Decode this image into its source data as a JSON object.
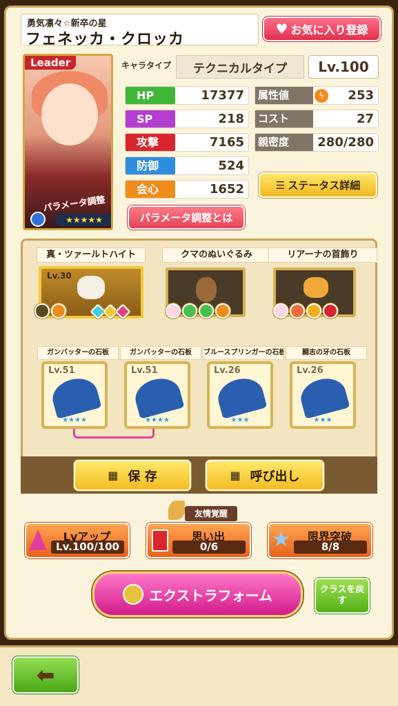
{
  "header": {
    "subtitle": "勇気凛々☆新卒の星",
    "name": "フェネッカ・クロッカ",
    "favorite_label": "お気に入り登録"
  },
  "portrait": {
    "leader": "Leader",
    "param_tag": "パラメータ調整",
    "stars": "★★★★★"
  },
  "chartype": {
    "label": "キャラタイプ",
    "value": "テクニカルタイプ",
    "level": "Lv.100"
  },
  "stats": [
    {
      "label": "HP",
      "value": "17377",
      "color": "#3fb83a"
    },
    {
      "label": "SP",
      "value": "218",
      "color": "#b33ed1"
    },
    {
      "label": "攻撃",
      "value": "7165",
      "color": "#d9252d"
    },
    {
      "label": "防御",
      "value": "524",
      "color": "#2f8de0"
    },
    {
      "label": "会心",
      "value": "1652",
      "color": "#f08c1c"
    }
  ],
  "stats2": [
    {
      "label": "属性値",
      "value": "253"
    },
    {
      "label": "コスト",
      "value": "27"
    },
    {
      "label": "親密度",
      "value": "280/280"
    }
  ],
  "buttons": {
    "status_detail": "ステータス詳細",
    "param_about": "パラメータ調整とは",
    "save": "保 存",
    "load": "呼び出し",
    "level_up": "Lvアップ",
    "memory": "思い出",
    "limit_break": "限界突破",
    "extra_form": "エクストラフォーム",
    "class_back": "クラスを戻す",
    "friendship": "友情覚醒"
  },
  "equipment": [
    {
      "name": "真・ツァールトハイト",
      "level": "Lv.30"
    },
    {
      "name": "クマのぬいぐるみ",
      "level": ""
    },
    {
      "name": "リアーナの首飾り",
      "level": ""
    }
  ],
  "slates": [
    {
      "name": "ガンバッターの石板",
      "level": "Lv.51",
      "stars": "★★★★"
    },
    {
      "name": "ガンバッターの石板",
      "level": "Lv.51",
      "stars": "★★★★"
    },
    {
      "name": "ブルースプリンガーの石板",
      "level": "Lv.26",
      "stars": "★★★"
    },
    {
      "name": "闘志の牙の石板",
      "level": "Lv.26",
      "stars": "★★★"
    }
  ],
  "progress": {
    "level": "Lv.100/100",
    "memory": "0/6",
    "limit": "8/8"
  }
}
